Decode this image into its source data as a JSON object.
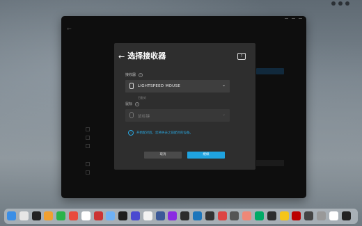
{
  "menubar": {
    "status_line1": "",
    "status_line2": ""
  },
  "modal": {
    "title": "选择接收器",
    "receiver_label": "接收器",
    "receiver_value": "LIGHTSPEED MOUSE",
    "pair_hint": "已配对",
    "mouse_label": "鼠标",
    "mouse_placeholder": "鼠标键",
    "notice": "开始配对后，您将失去之前配对的设备。",
    "cancel_label": "取消",
    "ok_label": "继续"
  },
  "colors": {
    "accent": "#1fa3e0",
    "modal_bg": "#2e2e2e",
    "app_bg": "#161616"
  },
  "icons": [
    "back-arrow-icon",
    "receiver-icon",
    "mouse-icon",
    "info-icon",
    "chevron-down-icon",
    "help-icon"
  ],
  "dock": {
    "app_count": 28
  }
}
